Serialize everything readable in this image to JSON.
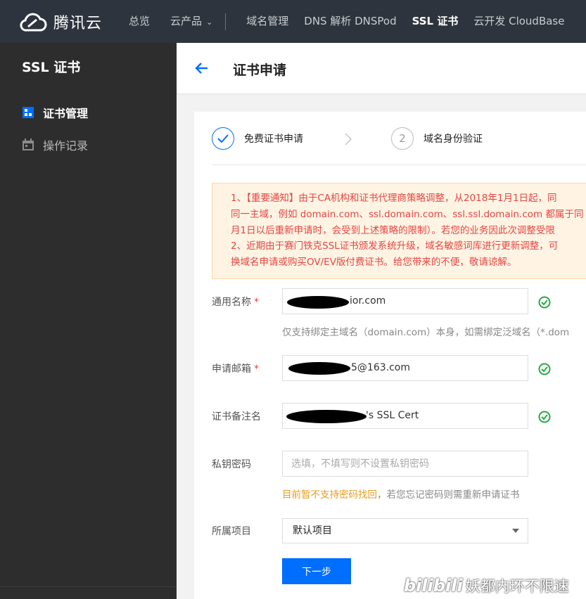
{
  "topbar": {
    "brand": "腾讯云",
    "nav": {
      "overview": "总览",
      "products": "云产品",
      "domains": "域名管理",
      "dns": "DNS 解析 DNSPod",
      "ssl": "SSL 证书",
      "cloudbase": "云开发 CloudBase"
    }
  },
  "sidebar": {
    "title": "SSL 证书",
    "items": [
      {
        "label": "证书管理",
        "icon": "certificate-icon",
        "active": true
      },
      {
        "label": "操作记录",
        "icon": "calendar-icon",
        "active": false
      }
    ]
  },
  "header": {
    "title": "证书申请"
  },
  "steps": [
    {
      "label": "免费证书申请",
      "state": "done"
    },
    {
      "label": "域名身份验证",
      "number": "2",
      "state": "pending"
    }
  ],
  "notice": {
    "lines": [
      "1、【重要通知】由于CA机构和证书代理商策略调整，从2018年1月1日起，同",
      "同一主域，例如 domain.com、ssl.domain.com、ssl.ssl.domain.com 都属于同",
      "月1日以后重新申请时，会受到上述策略的限制）。若您的业务因此次调整受限",
      "2、近期由于赛门铁克SSL证书颁发系统升级，域名敏感词库进行更新调整，可",
      "换域名申请或购买OV/EV版付费证书。给您带来的不便，敬请谅解。"
    ]
  },
  "form": {
    "common_name": {
      "label": "通用名称",
      "required": "*",
      "value": "ior.com"
    },
    "common_name_hint": "仅支持绑定主域名（domain.com）本身，如需绑定泛域名（*.dom",
    "email": {
      "label": "申请邮箱",
      "required": "*",
      "value": "5@163.com"
    },
    "cert_note": {
      "label": "证书备注名",
      "value": "'s SSL Cert"
    },
    "key_password": {
      "label": "私钥密码",
      "placeholder": "选填，不填写则不设置私钥密码"
    },
    "password_hint_warn": "目前暂不支持密码找回",
    "password_hint_rest": "，若您忘记密码则需重新申请证书",
    "project": {
      "label": "所属项目",
      "value": "默认项目"
    },
    "next_button": "下一步"
  },
  "watermark": {
    "logo": "bilibili",
    "text": "妖都内环不限速"
  },
  "colors": {
    "accent": "#006eff",
    "success": "#29a745",
    "warn": "#e89c1a",
    "error": "#e54545",
    "topbar": "#2d343d",
    "sidebar": "#2d2d2d"
  }
}
